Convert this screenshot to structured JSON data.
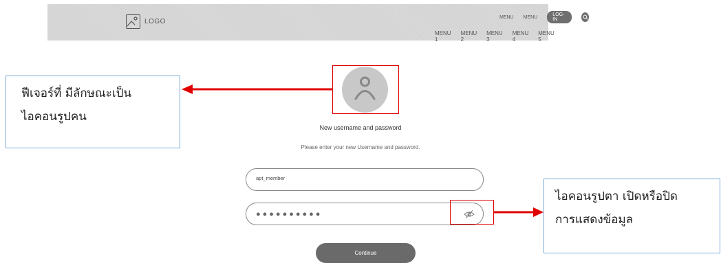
{
  "header": {
    "logo_text": "LOGO",
    "top_menu": [
      "MENU",
      "MENU"
    ],
    "login_label": "LOG-IN",
    "main_menu": [
      "MENU 1",
      "MENU 2",
      "MENU 3",
      "MENU 4",
      "MENU 5"
    ]
  },
  "form": {
    "title": "New username and password",
    "subtitle": "Please enter your new Username and password.",
    "username_value": "apt_member",
    "password_mask": "●●●●●●●●●●",
    "continue_label": "Continue"
  },
  "annotations": {
    "avatar_note_line1": "ฟีเจอร์ที่ มีลักษณะเป็น",
    "avatar_note_line2": "ไอคอนรูปคน",
    "eye_note_line1": "ไอคอนรูปตา เปิดหรือปิด",
    "eye_note_line2": "การแสดงข้อมูล"
  },
  "colors": {
    "header_bg": "#d9d9d9",
    "highlight": "#e00000",
    "note_border": "#7aa7d6",
    "button_bg": "#6a6a6a"
  }
}
